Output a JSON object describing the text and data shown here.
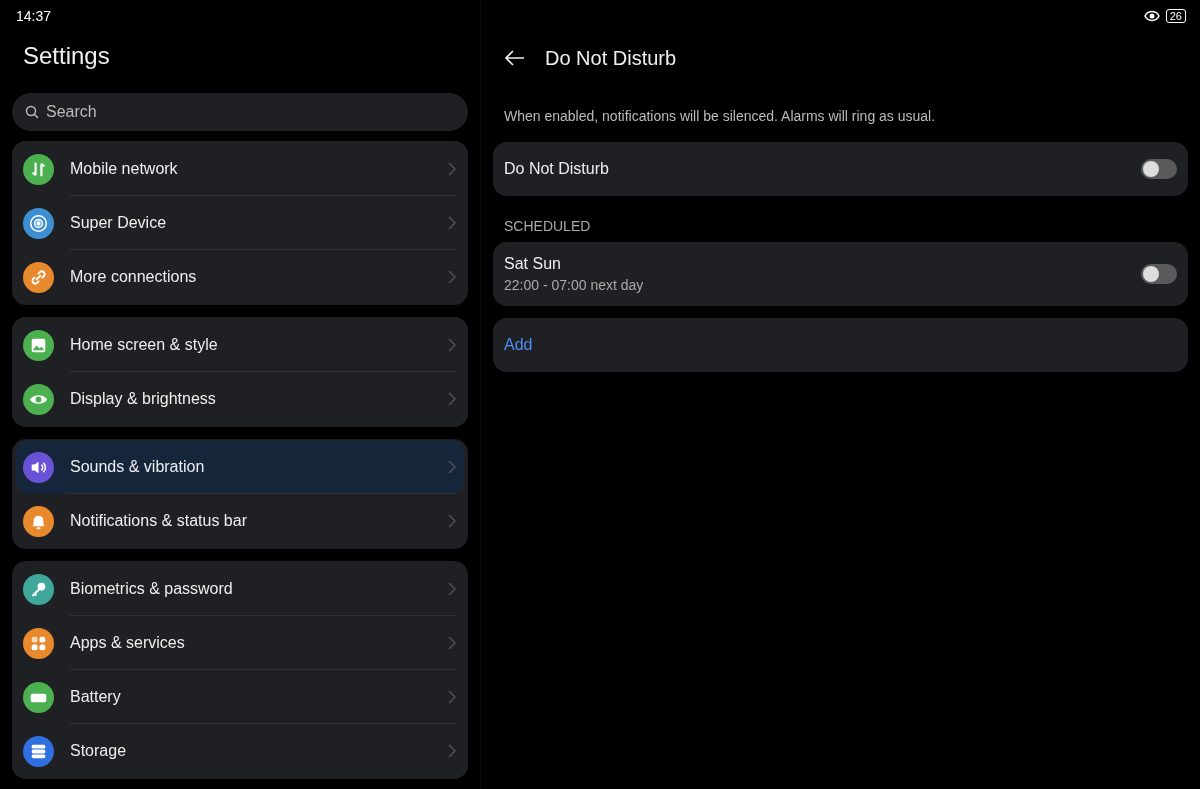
{
  "status_bar": {
    "time": "14:37",
    "battery": "26"
  },
  "sidebar": {
    "title": "Settings",
    "search": {
      "placeholder": "Search"
    },
    "groups": [
      {
        "items": [
          {
            "label": "Mobile network",
            "kind": "network",
            "color": "#4caf50",
            "selected": false
          },
          {
            "label": "Super Device",
            "kind": "device",
            "color": "#3d8fd1",
            "selected": false
          },
          {
            "label": "More connections",
            "kind": "link",
            "color": "#e8892e",
            "selected": false
          }
        ]
      },
      {
        "items": [
          {
            "label": "Home screen & style",
            "kind": "image",
            "color": "#4caf50",
            "selected": false
          },
          {
            "label": "Display & brightness",
            "kind": "eye",
            "color": "#4caf50",
            "selected": false
          }
        ]
      },
      {
        "items": [
          {
            "label": "Sounds & vibration",
            "kind": "sound",
            "color": "#6a52d6",
            "selected": true
          },
          {
            "label": "Notifications & status bar",
            "kind": "bell",
            "color": "#e8892e",
            "selected": false
          }
        ]
      },
      {
        "items": [
          {
            "label": "Biometrics & password",
            "kind": "key",
            "color": "#3fa89a",
            "selected": false
          },
          {
            "label": "Apps & services",
            "kind": "apps",
            "color": "#e8892e",
            "selected": false
          },
          {
            "label": "Battery",
            "kind": "battery",
            "color": "#4caf50",
            "selected": false
          },
          {
            "label": "Storage",
            "kind": "storage",
            "color": "#2f6fe0",
            "selected": false
          }
        ]
      }
    ]
  },
  "detail": {
    "title": "Do Not Disturb",
    "description": "When enabled, notifications will be silenced. Alarms will ring as usual.",
    "main_toggle": {
      "label": "Do Not Disturb",
      "on": false
    },
    "section_header": "SCHEDULED",
    "schedules": [
      {
        "days": "Sat Sun",
        "time": "22:00 - 07:00 next day",
        "on": false
      }
    ],
    "add_button": "Add"
  }
}
